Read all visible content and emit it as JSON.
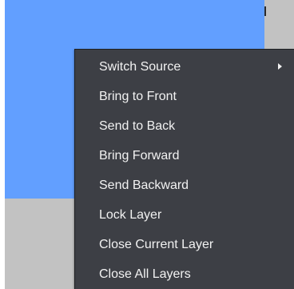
{
  "context_menu": {
    "items": [
      {
        "label": "Switch Source",
        "has_submenu": true,
        "submenu_icon": "chevron-right-icon"
      },
      {
        "label": "Bring to Front"
      },
      {
        "label": "Send to Back"
      },
      {
        "label": "Bring Forward"
      },
      {
        "label": "Send Backward"
      },
      {
        "label": "Lock Layer"
      },
      {
        "label": "Close Current Layer"
      },
      {
        "label": "Close All Layers"
      }
    ]
  },
  "colors": {
    "layer_fill": "#629fff",
    "canvas_background": "#c2c2c2",
    "menu_background": "#3d3f45",
    "menu_text": "#f2f2f2"
  }
}
